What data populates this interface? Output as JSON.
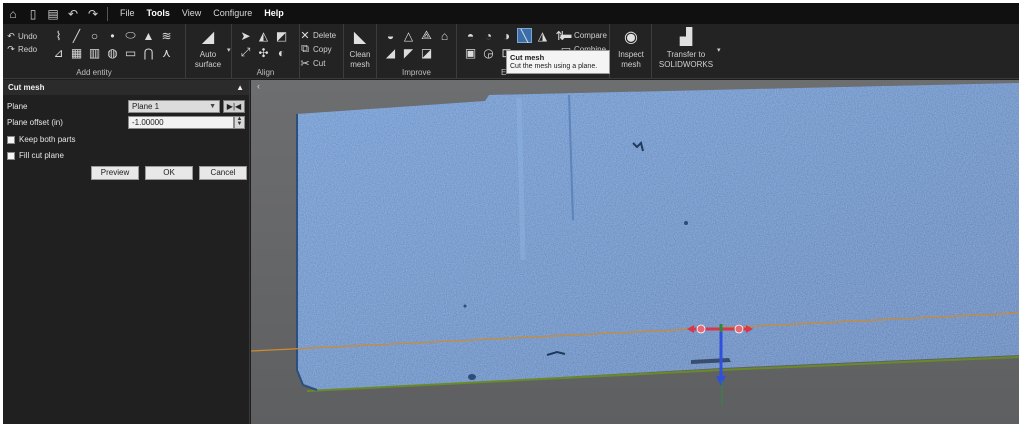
{
  "menubar": {
    "quick_icons": [
      "home-icon",
      "new-file-icon",
      "save-icon",
      "undo-history-icon",
      "redo-history-icon"
    ],
    "items": [
      {
        "label": "File",
        "bold": false
      },
      {
        "label": "Tools",
        "bold": true
      },
      {
        "label": "View",
        "bold": false
      },
      {
        "label": "Configure",
        "bold": false
      },
      {
        "label": "Help",
        "bold": true
      }
    ]
  },
  "ribbon": {
    "undo_label": "Undo",
    "redo_label": "Redo",
    "add_entity_label": "Add entity",
    "auto_surface_label": "Auto surface",
    "align_label": "Align",
    "delete_label": "Delete",
    "copy_label": "Copy",
    "cut_label": "Cut",
    "clean_mesh_label": "Clean mesh",
    "improve_label": "Improve",
    "compare_label": "Compare",
    "combine_label": "Combine",
    "edit_group_label": "E",
    "inspect_mesh_label": "Inspect mesh",
    "transfer_label": "Transfer to SOLIDWORKS"
  },
  "tooltip": {
    "title": "Cut mesh",
    "description": "Cut the mesh using a plane."
  },
  "panel": {
    "title": "Cut mesh",
    "collapse_icon": "chevron-up-icon",
    "plane_label": "Plane",
    "plane_value": "Plane 1",
    "plane_offset_label": "Plane offset (in)",
    "plane_offset_value": "-1.00000",
    "keep_both_parts_label": "Keep both parts",
    "fill_cut_plane_label": "Fill cut plane",
    "preview_label": "Preview",
    "ok_label": "OK",
    "cancel_label": "Cancel"
  },
  "colors": {
    "mesh": "#4d86c6",
    "plane_line": "#d08a2a",
    "axis_red": "#d9364a",
    "axis_blue": "#2e4fe0",
    "axis_green": "#2e8a3a"
  }
}
